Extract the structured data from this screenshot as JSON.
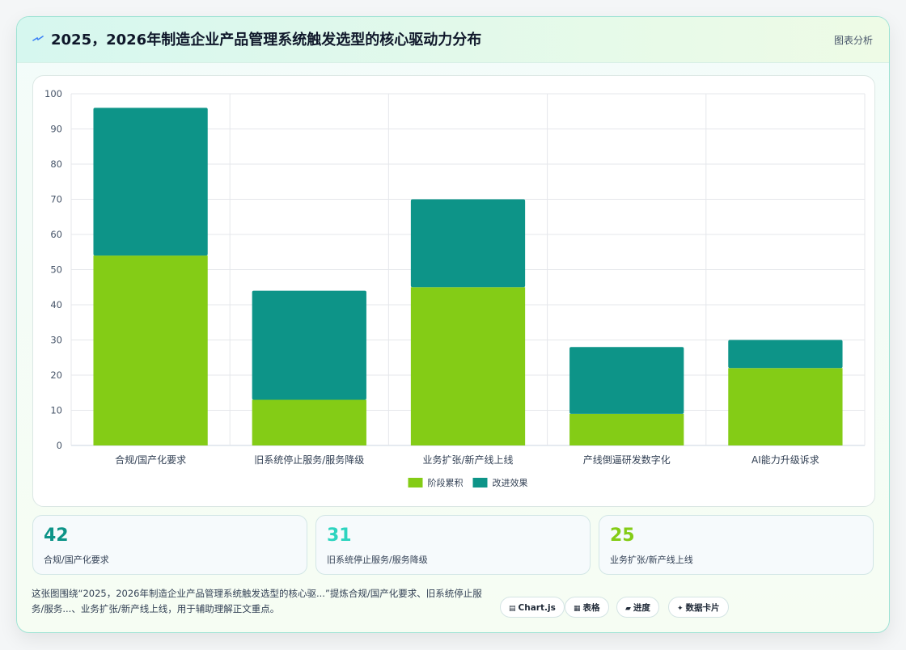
{
  "header": {
    "icon": "sparkle-icon",
    "title": "2025，2026年制造企业产品管理系统触发选型的核心驱动力分布",
    "badge": "图表分析"
  },
  "colors": {
    "series_a": "#84cc16",
    "series_b": "#0d9488",
    "stat_1": "#0d9488",
    "stat_2": "#2dd4bf",
    "stat_3": "#84cc16"
  },
  "chart_data": {
    "type": "bar",
    "stacked": true,
    "categories": [
      "合规/国产化要求",
      "旧系统停止服务/服务降级",
      "业务扩张/新产线上线",
      "产线倒逼研发数字化",
      "AI能力升级诉求"
    ],
    "series": [
      {
        "name": "阶段累积",
        "values": [
          54,
          13,
          45,
          9,
          22
        ]
      },
      {
        "name": "改进效果",
        "values": [
          42,
          31,
          25,
          19,
          8
        ]
      }
    ],
    "ylim": [
      0,
      100
    ],
    "yticks": [
      0,
      10,
      20,
      30,
      40,
      50,
      60,
      70,
      80,
      90,
      100
    ],
    "grid": true,
    "legend_position": "bottom"
  },
  "stats": [
    {
      "value": "42",
      "label": "合规/国产化要求"
    },
    {
      "value": "31",
      "label": "旧系统停止服务/服务降级"
    },
    {
      "value": "25",
      "label": "业务扩张/新产线上线"
    }
  ],
  "footer": {
    "text": "这张图围绕“2025，2026年制造企业产品管理系统触发选型的核心驱...”提炼合规/国产化要求、旧系统停止服务/服务...、业务扩张/新产线上线，用于辅助理解正文重点。",
    "chips": [
      {
        "icon": "chart-icon",
        "glyph": "▤",
        "label": "Chart.js"
      },
      {
        "icon": "table-icon",
        "glyph": "▦",
        "label": "表格"
      },
      {
        "icon": "progress-icon",
        "glyph": "▰",
        "label": "进度"
      },
      {
        "icon": "card-icon",
        "glyph": "✦",
        "label": "数据卡片"
      }
    ]
  }
}
